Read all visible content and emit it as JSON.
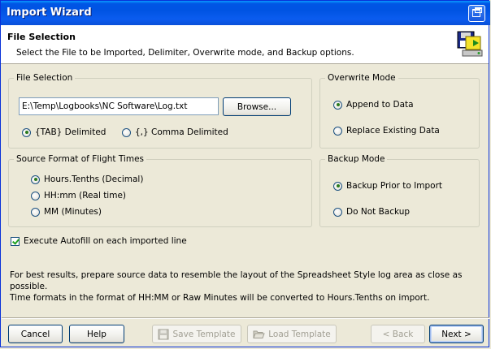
{
  "window": {
    "title": "Import Wizard"
  },
  "header": {
    "title": "File Selection",
    "description": "Select the File to be Imported, Delimiter, Overwrite mode, and Backup options."
  },
  "file_selection": {
    "group_label": "File Selection",
    "path_value": "E:\\Temp\\Logbooks\\NC Software\\Log.txt",
    "browse_label": "Browse...",
    "delimiters": [
      {
        "label": "{TAB} Delimited",
        "selected": true
      },
      {
        "label": "{,} Comma Delimited",
        "selected": false
      }
    ]
  },
  "overwrite_mode": {
    "group_label": "Overwrite Mode",
    "options": [
      {
        "label": "Append to Data",
        "selected": true
      },
      {
        "label": "Replace Existing Data",
        "selected": false
      }
    ]
  },
  "source_format": {
    "group_label": "Source Format of Flight Times",
    "options": [
      {
        "label": "Hours.Tenths (Decimal)",
        "selected": true
      },
      {
        "label": "HH:mm (Real time)",
        "selected": false
      },
      {
        "label": "MM (Minutes)",
        "selected": false
      }
    ]
  },
  "backup_mode": {
    "group_label": "Backup Mode",
    "options": [
      {
        "label": "Backup Prior to Import",
        "selected": true
      },
      {
        "label": "Do Not Backup",
        "selected": false
      }
    ]
  },
  "autofill": {
    "label": "Execute Autofill on each imported line",
    "checked": true
  },
  "info_text": {
    "line1": "For best results, prepare source data to resemble the layout of the Spreadsheet Style log area as close as possible.",
    "line2": "Time formats in the format of HH:MM or Raw Minutes will be converted to Hours.Tenths on import."
  },
  "buttons": {
    "cancel": "Cancel",
    "help": "Help",
    "save_template": "Save Template",
    "load_template": "Load Template",
    "back": "< Back",
    "next": "Next >"
  },
  "icons": {
    "window_button": "restore-icon",
    "header": "import-disk-icon",
    "save_template": "floppy-disk-icon",
    "load_template": "folder-open-icon"
  }
}
